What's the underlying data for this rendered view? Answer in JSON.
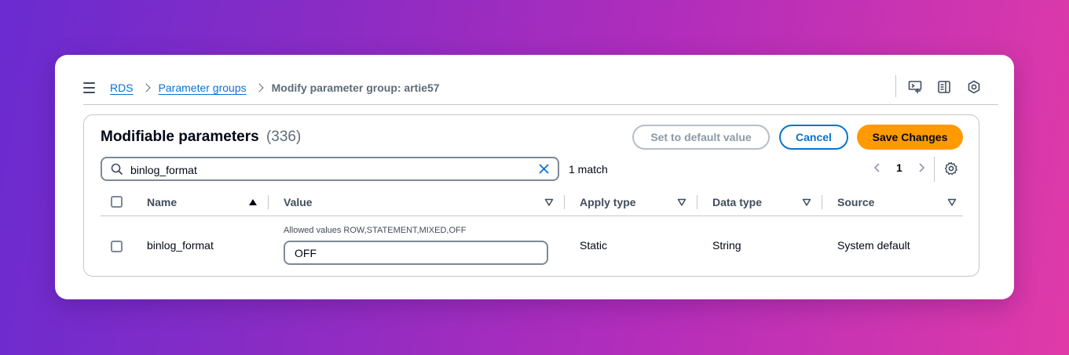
{
  "breadcrumb": {
    "root": "RDS",
    "parent": "Parameter groups",
    "current": "Modify parameter group: artie57"
  },
  "panel": {
    "title": "Modifiable parameters",
    "count": "(336)",
    "set_default_label": "Set to default value",
    "cancel_label": "Cancel",
    "save_label": "Save Changes"
  },
  "search": {
    "value": "binlog_format",
    "match_text": "1 match"
  },
  "pagination": {
    "current_page": "1"
  },
  "table": {
    "columns": [
      "Name",
      "Value",
      "Apply type",
      "Data type",
      "Source"
    ],
    "rows": [
      {
        "name": "binlog_format",
        "allowed": "Allowed values ROW,STATEMENT,MIXED,OFF",
        "value": "OFF",
        "apply_type": "Static",
        "data_type": "String",
        "source": "System default"
      }
    ]
  },
  "colors": {
    "accent": "#0972d3",
    "primary_button": "#ff9900"
  }
}
